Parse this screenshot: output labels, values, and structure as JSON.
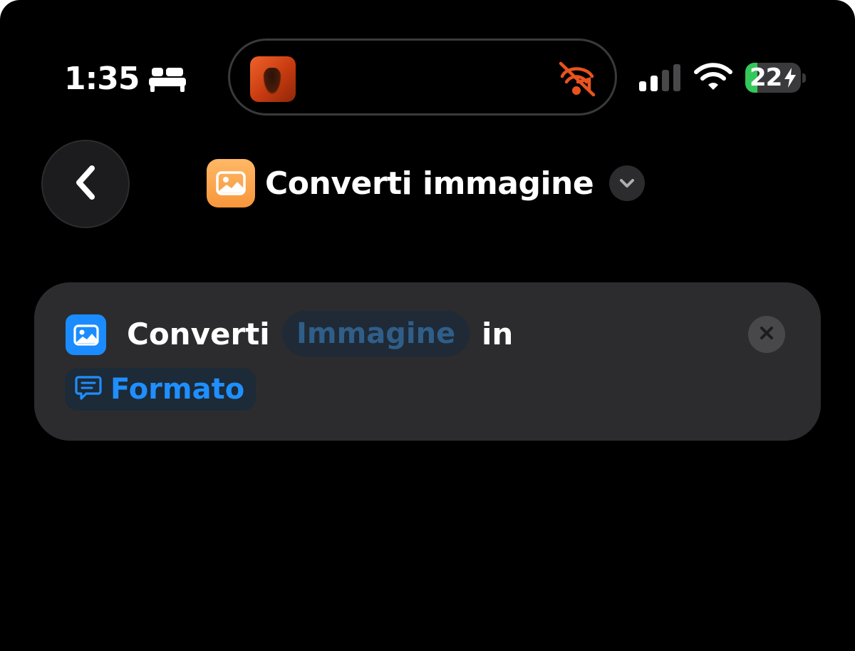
{
  "status_bar": {
    "time": "1:35",
    "bed_icon": "bed-icon",
    "battery_percent": "22",
    "battery_level": 0.22,
    "signal_bars_active": 2,
    "signal_bars_total": 4,
    "colors": {
      "battery": "#34c759",
      "muted": "#e8531f"
    }
  },
  "dynamic_island": {
    "now_playing_art": "album-art",
    "muted_icon": "speaker-muted-icon"
  },
  "header": {
    "title": "Converti immagine",
    "app_icon": "photo-icon",
    "app_icon_color": "#f7963b"
  },
  "action": {
    "icon": "photo-icon",
    "icon_color": "#1a8cff",
    "verb": "Converti",
    "input_token": "Immagine",
    "preposition": "in",
    "format_token": "Formato",
    "format_icon": "speech-bubble-icon"
  }
}
